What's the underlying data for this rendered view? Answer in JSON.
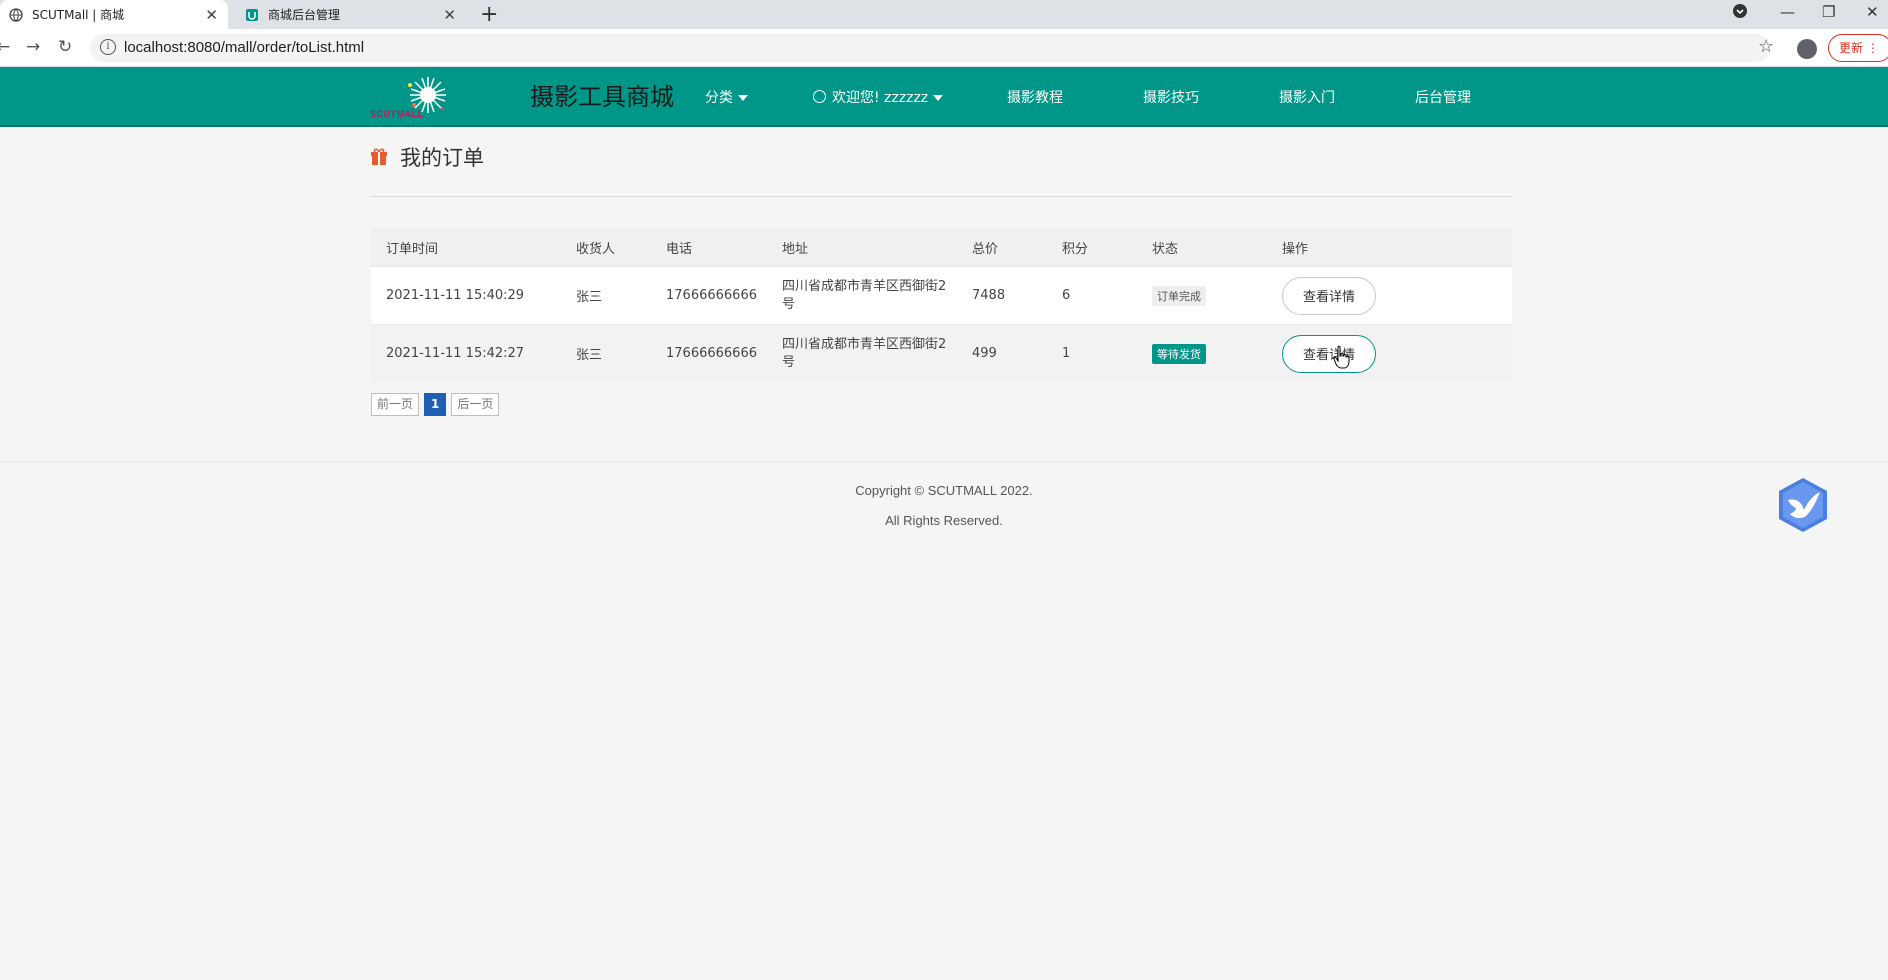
{
  "browser": {
    "tabs": [
      {
        "title": "SCUTMall | 商城",
        "active": true
      },
      {
        "title": "商城后台管理",
        "active": false
      }
    ],
    "url": "localhost:8080/mall/order/toList.html",
    "update_label": "更新"
  },
  "header": {
    "logo_text": "SCUTMALL",
    "site_title": "摄影工具商城",
    "nav": {
      "category": "分类",
      "welcome": "欢迎您! zzzzzz",
      "tutorial": "摄影教程",
      "skills": "摄影技巧",
      "intro": "摄影入门",
      "admin": "后台管理"
    }
  },
  "page": {
    "title": "我的订单"
  },
  "table": {
    "headers": {
      "time": "订单时间",
      "receiver": "收货人",
      "phone": "电话",
      "address": "地址",
      "total": "总价",
      "points": "积分",
      "status": "状态",
      "action": "操作"
    },
    "rows": [
      {
        "time": "2021-11-11 15:40:29",
        "receiver": "张三",
        "phone": "17666666666",
        "address": "四川省成都市青羊区西御街2号",
        "total": "7488",
        "points": "6",
        "status": "订单完成",
        "action": "查看详情"
      },
      {
        "time": "2021-11-11 15:42:27",
        "receiver": "张三",
        "phone": "17666666666",
        "address": "四川省成都市青羊区西御街2号",
        "total": "499",
        "points": "1",
        "status": "等待发货",
        "action": "查看详情"
      }
    ]
  },
  "pager": {
    "prev": "前一页",
    "current": "1",
    "next": "后一页"
  },
  "footer": {
    "line1": "Copyright © SCUTMALL 2022.",
    "line2": "All Rights Reserved."
  },
  "colors": {
    "header_bg": "#009688",
    "status_waiting": "#009688",
    "pager_current": "#1e5fb4",
    "accent_icon": "#e65c2e"
  }
}
